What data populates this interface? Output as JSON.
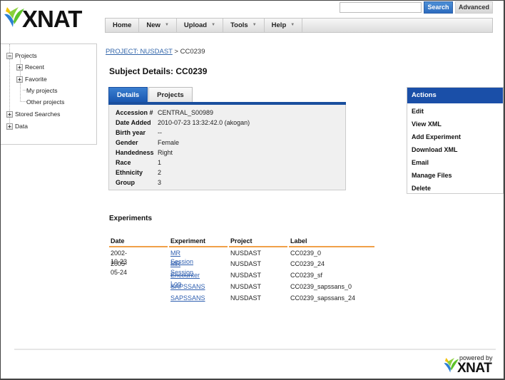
{
  "app": {
    "logo_text": "XNAT"
  },
  "search": {
    "placeholder": "",
    "value": "",
    "button_label": "Search",
    "advanced_label": "Advanced"
  },
  "nav": {
    "items": [
      {
        "label": "Home",
        "has_menu": false
      },
      {
        "label": "New",
        "has_menu": true
      },
      {
        "label": "Upload",
        "has_menu": true
      },
      {
        "label": "Tools",
        "has_menu": true
      },
      {
        "label": "Help",
        "has_menu": true
      }
    ],
    "caret": "▼"
  },
  "tree": {
    "projects": {
      "label": "Projects",
      "toggle": "−"
    },
    "recent": {
      "label": "Recent",
      "toggle": "+"
    },
    "favorite": {
      "label": "Favorite",
      "toggle": "+"
    },
    "my_projects": {
      "label": "My projects"
    },
    "other_projects": {
      "label": "Other projects"
    },
    "stored_searches": {
      "label": "Stored Searches",
      "toggle": "+"
    },
    "data": {
      "label": "Data",
      "toggle": "+"
    }
  },
  "breadcrumb": {
    "project_link": "PROJECT: NUSDAST",
    "separator": " > ",
    "current": "CC0239"
  },
  "page": {
    "title": "Subject Details: CC0239"
  },
  "tabs": [
    {
      "label": "Details",
      "active": true
    },
    {
      "label": "Projects",
      "active": false
    }
  ],
  "details": [
    {
      "key": "Accession #",
      "value": "CENTRAL_S00989"
    },
    {
      "key": "Date Added",
      "value": "2010-07-23 13:32:42.0 (akogan)"
    },
    {
      "key": "Birth year",
      "value": "--"
    },
    {
      "key": "Gender",
      "value": "Female"
    },
    {
      "key": "Handedness",
      "value": "Right"
    },
    {
      "key": "Race",
      "value": "1"
    },
    {
      "key": "Ethnicity",
      "value": "2"
    },
    {
      "key": "Group",
      "value": "3"
    }
  ],
  "actions": {
    "header": "Actions",
    "items": [
      "Edit",
      "View XML",
      "Add Experiment",
      "Download XML",
      "Email",
      "Manage Files",
      "Delete"
    ]
  },
  "experiments": {
    "title": "Experiments",
    "columns": [
      "Date",
      "Experiment",
      "Project",
      "Label"
    ],
    "rows": [
      {
        "date": "2002-10-23",
        "experiment": "MR Session",
        "project": "NUSDAST",
        "label": "CC0239_0"
      },
      {
        "date": "2005-05-24",
        "experiment": "MR Session",
        "project": "NUSDAST",
        "label": "CC0239_24"
      },
      {
        "date": "",
        "experiment": "Encounter Log",
        "project": "NUSDAST",
        "label": "CC0239_sf"
      },
      {
        "date": "",
        "experiment": "SAPSSANS",
        "project": "NUSDAST",
        "label": "CC0239_sapssans_0"
      },
      {
        "date": "",
        "experiment": "SAPSSANS",
        "project": "NUSDAST",
        "label": "CC0239_sapssans_24"
      }
    ]
  },
  "footer": {
    "powered_by": "powered by",
    "brand": "XNAT"
  },
  "colors": {
    "primary_blue": "#1a4fa8",
    "accent_orange": "#f0a048",
    "link_blue": "#2f5fb0"
  }
}
